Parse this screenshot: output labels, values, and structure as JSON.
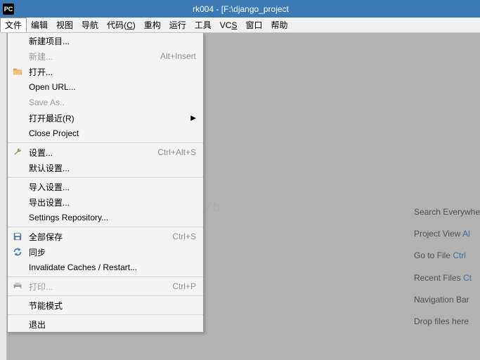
{
  "titlebar": {
    "logo": "PC",
    "title": "rk004 - [F:\\django_project"
  },
  "menubar": {
    "file": "文件",
    "edit": "编辑",
    "view": "视图",
    "navigate": "导航",
    "code_pre": "代码(",
    "code_ul": "C",
    "code_post": ")",
    "refactor": "重构",
    "run": "运行",
    "tools": "工具",
    "vcs_pre": "VC",
    "vcs_ul": "S",
    "window": "窗口",
    "help": "帮助"
  },
  "dropdown": {
    "new_project": "新建项目...",
    "new": "新建...",
    "new_sc": "Alt+Insert",
    "open": "打开...",
    "open_url": "Open URL...",
    "save_as": "Save As..",
    "open_recent": "打开最近(R)",
    "close_project": "Close Project",
    "settings": "设置...",
    "settings_sc": "Ctrl+Alt+S",
    "default_settings": "默认设置...",
    "import_settings": "导入设置...",
    "export_settings": "导出设置...",
    "settings_repo": "Settings Repository...",
    "save_all": "全部保存",
    "save_all_sc": "Ctrl+S",
    "sync": "同步",
    "invalidate": "Invalidate Caches / Restart...",
    "print": "打印...",
    "print_sc": "Ctrl+P",
    "power_save": "节能模式",
    "exit": "退出"
  },
  "hints": {
    "search": "Search Everywhe",
    "project_a": "Project View ",
    "project_b": "Al",
    "gotofile_a": "Go to File ",
    "gotofile_b": "Ctrl",
    "recent_a": "Recent Files ",
    "recent_b": "Ct",
    "navbar": "Navigation Bar ",
    "drop": "Drop files here"
  },
  "watermark": "http://b"
}
